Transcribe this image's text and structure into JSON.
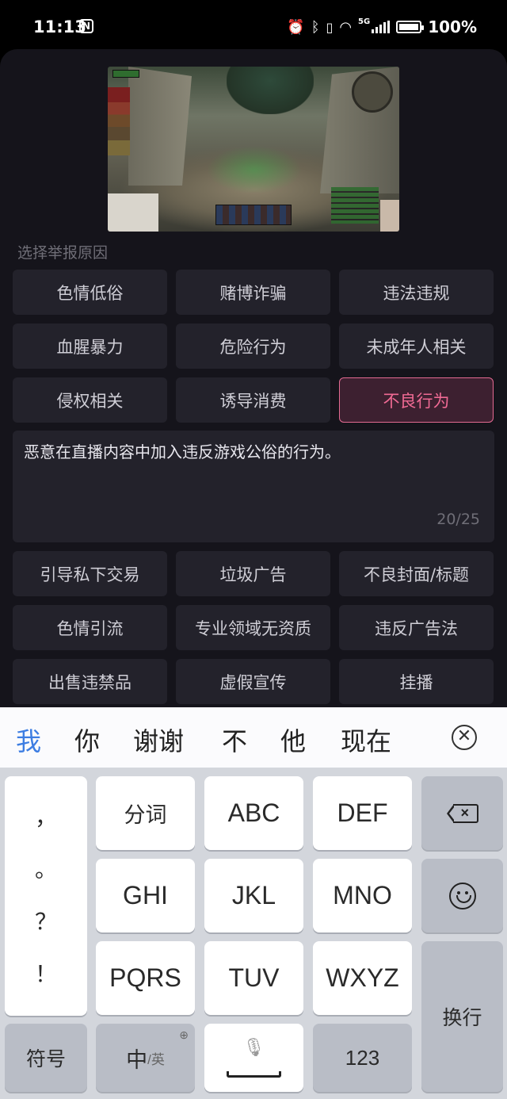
{
  "status_bar": {
    "time": "11:13",
    "battery": "100%",
    "network": "5G",
    "icons": [
      "nfc-icon",
      "alarm-icon",
      "bluetooth-icon",
      "vibrate-icon",
      "wifi-icon",
      "signal-icon",
      "battery-icon"
    ]
  },
  "report": {
    "section_label": "选择举报原因",
    "reasons_top": [
      "色情低俗",
      "赌博诈骗",
      "违法违规",
      "血腥暴力",
      "危险行为",
      "未成年人相关",
      "侵权相关",
      "诱导消费",
      "不良行为"
    ],
    "selected_reason": "不良行为",
    "description": "恶意在直播内容中加入违反游戏公俗的行为。",
    "char_count": "20/25",
    "reasons_bottom": [
      "引导私下交易",
      "垃圾广告",
      "不良封面/标题",
      "色情引流",
      "专业领域无资质",
      "违反广告法",
      "出售违禁品",
      "虚假宣传",
      "挂播"
    ]
  },
  "ime": {
    "candidates": [
      "我",
      "你",
      "谢谢",
      "不",
      "他",
      "现在"
    ],
    "punctuation": [
      "，",
      "。",
      "？",
      "！"
    ],
    "keys": {
      "row1": [
        "分词",
        "ABC",
        "DEF"
      ],
      "row2": [
        "GHI",
        "JKL",
        "MNO"
      ],
      "row3": [
        "PQRS",
        "TUV",
        "WXYZ"
      ],
      "enter": "换行",
      "symbols": "符号",
      "lang_main": "中",
      "lang_alt": "/英",
      "numbers": "123"
    }
  },
  "colors": {
    "panel_bg": "#15141b",
    "chip_bg": "#23222b",
    "selected_text": "#f06a94",
    "candidate_highlight": "#3d7de2",
    "keyboard_bg": "#d3d6dc"
  }
}
